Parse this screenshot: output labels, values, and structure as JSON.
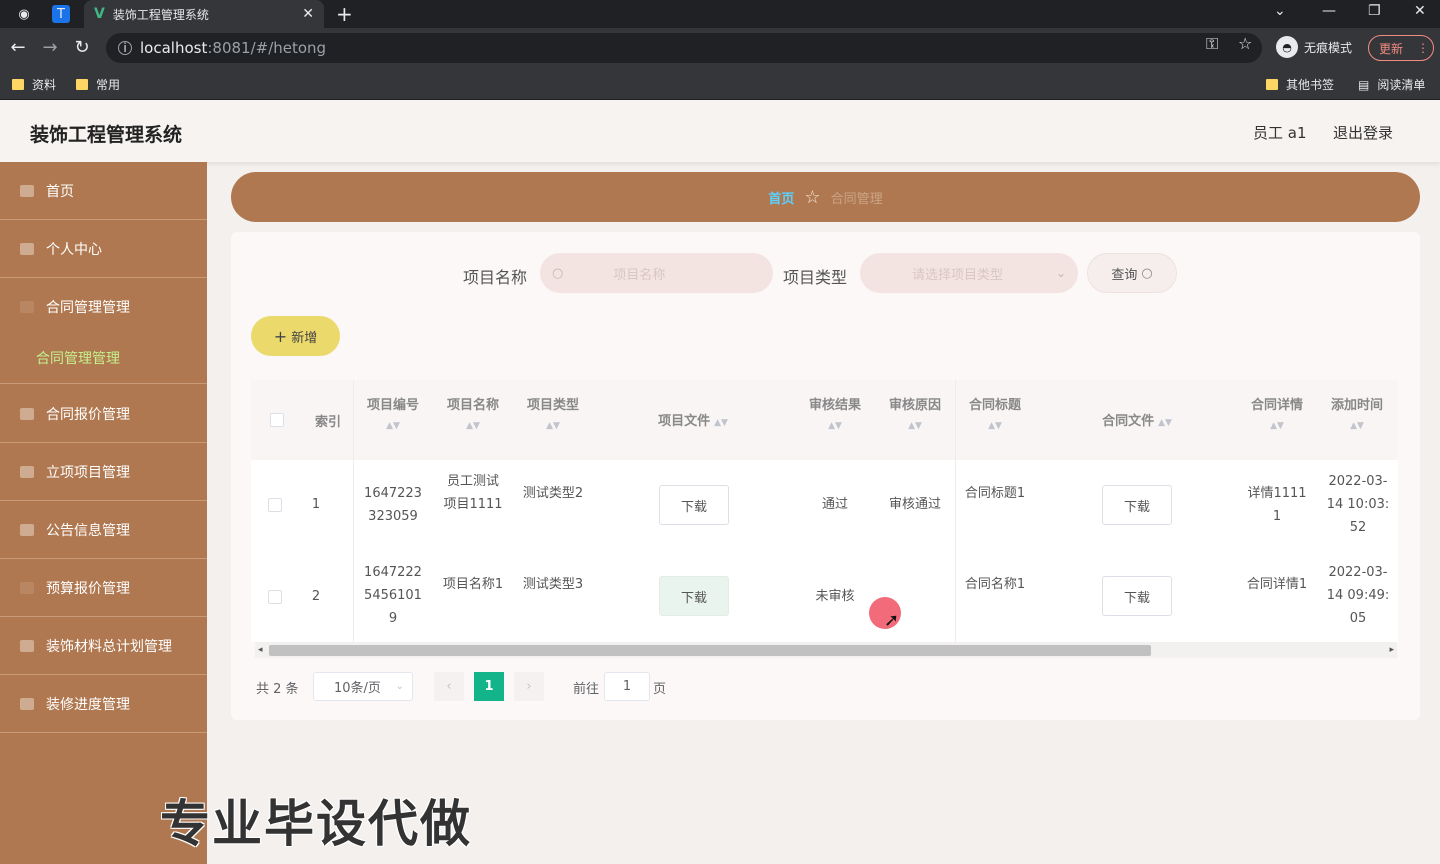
{
  "browser": {
    "tab_title": "装饰工程管理系统",
    "url_host": "localhost",
    "url_path": ":8081/#/hetong",
    "incognito_label": "无痕模式",
    "update_label": "更新",
    "bookmarks": [
      "资料",
      "常用"
    ],
    "bookmarks_right": [
      "其他书签",
      "阅读清单"
    ]
  },
  "header": {
    "title": "装饰工程管理系统",
    "user": "员工 a1",
    "logout": "退出登录"
  },
  "sidebar": {
    "items": [
      "首页",
      "个人中心",
      "合同管理管理",
      "合同报价管理",
      "立项项目管理",
      "公告信息管理",
      "预算报价管理",
      "装饰材料总计划管理",
      "装修进度管理"
    ],
    "active_sub": "合同管理管理"
  },
  "breadcrumb": {
    "home": "首页",
    "current": "合同管理"
  },
  "search": {
    "name_label": "项目名称",
    "name_placeholder": "项目名称",
    "type_label": "项目类型",
    "type_placeholder": "请选择项目类型",
    "query_label": "查询"
  },
  "toolbar": {
    "add_label": "新增"
  },
  "table": {
    "headers": {
      "index": "索引",
      "code": "项目编号",
      "name": "项目名称",
      "type": "项目类型",
      "file": "项目文件",
      "result": "审核结果",
      "reason": "审核原因",
      "contract_title": "合同标题",
      "contract_file": "合同文件",
      "contract_detail": "合同详情",
      "time": "添加时间"
    },
    "download_label": "下载",
    "rows": [
      {
        "index": "1",
        "code": "1647223323059",
        "name": "员工测试项目1111",
        "type": "测试类型2",
        "result": "通过",
        "reason": "审核通过",
        "contract_title": "合同标题1",
        "contract_detail": "详情11111",
        "time": "2022-03-14 10:03:52"
      },
      {
        "index": "2",
        "code": "16472225456101 9",
        "name": "项目名称1",
        "type": "测试类型3",
        "result": "未审核",
        "reason": "",
        "contract_title": "合同名称1",
        "contract_detail": "合同详情1",
        "time": "2022-03-14 09:49:05"
      }
    ]
  },
  "pagination": {
    "total": "共 2 条",
    "page_size": "10条/页",
    "current": "1",
    "goto_prefix": "前往",
    "goto_value": "1",
    "goto_suffix": "页"
  },
  "watermark": "专业毕设代做",
  "colors": {
    "sidebar": "#b07850",
    "accent_green": "#13b48a",
    "add_button": "#ecd96c"
  }
}
